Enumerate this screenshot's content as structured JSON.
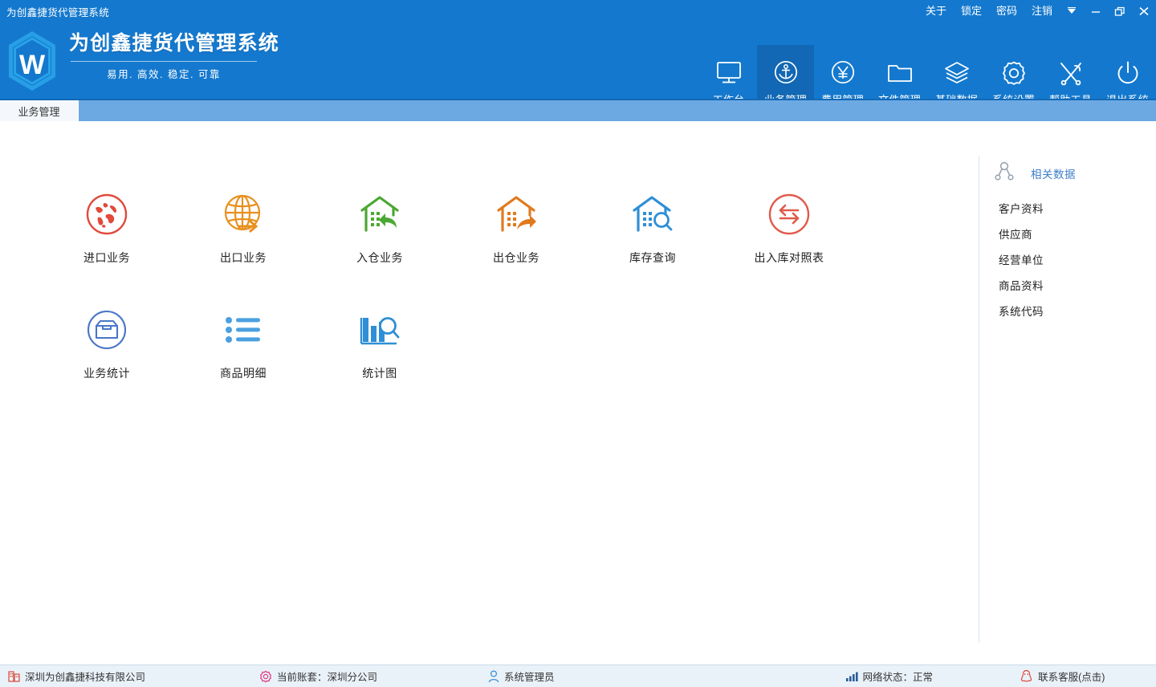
{
  "window": {
    "title": "为创鑫捷货代管理系统",
    "menu_links": [
      {
        "label": "关于",
        "name": "about"
      },
      {
        "label": "锁定",
        "name": "lock"
      },
      {
        "label": "密码",
        "name": "password"
      },
      {
        "label": "注销",
        "name": "logout"
      }
    ],
    "controls": [
      {
        "name": "skin-dropdown-icon",
        "glyph": "▼"
      },
      {
        "name": "minimize-icon",
        "glyph": "–"
      },
      {
        "name": "restore-icon",
        "glyph": "❐"
      },
      {
        "name": "close-icon",
        "glyph": "✕"
      }
    ]
  },
  "banner": {
    "logo_letter": "W",
    "title": "为创鑫捷货代管理系统",
    "subtitle": "易用. 高效. 稳定. 可靠",
    "bg_color": "#1479CE"
  },
  "topnav": {
    "active_index": 1,
    "items": [
      {
        "label": "工作台",
        "icon": "monitor-icon"
      },
      {
        "label": "业务管理",
        "icon": "anchor-circle-icon"
      },
      {
        "label": "费用管理",
        "icon": "yuan-circle-icon"
      },
      {
        "label": "文件管理",
        "icon": "folder-icon"
      },
      {
        "label": "基础数据",
        "icon": "layers-icon"
      },
      {
        "label": "系统设置",
        "icon": "gear-icon"
      },
      {
        "label": "帮助工具",
        "icon": "tools-icon"
      },
      {
        "label": "退出系统",
        "icon": "power-icon"
      }
    ]
  },
  "tabs": [
    {
      "label": "业务管理",
      "active": true
    }
  ],
  "main": {
    "tiles": [
      {
        "label": "进口业务",
        "icon": "globe-circle-icon",
        "color": "#E04A3A"
      },
      {
        "label": "出口业务",
        "icon": "globe-arrow-icon",
        "color": "#E8901E"
      },
      {
        "label": "入仓业务",
        "icon": "warehouse-in-icon",
        "color": "#4CA832"
      },
      {
        "label": "出仓业务",
        "icon": "warehouse-out-icon",
        "color": "#E07A1E"
      },
      {
        "label": "库存查询",
        "icon": "warehouse-search-icon",
        "color": "#2E8FD6"
      },
      {
        "label": "出入库对照表",
        "icon": "exchange-circle-icon",
        "color": "#E05A4A"
      },
      {
        "label": "业务统计",
        "icon": "archive-circle-icon",
        "color": "#4A76C8"
      },
      {
        "label": "商品明细",
        "icon": "list-icon",
        "color": "#4AA0E0"
      },
      {
        "label": "统计图",
        "icon": "bar-chart-search-icon",
        "color": "#2E8FD6"
      }
    ]
  },
  "right_panel": {
    "header": "相关数据",
    "header_icon": "relation-node-icon",
    "header_color": "#3F7FC8",
    "items": [
      {
        "label": "客户资料"
      },
      {
        "label": "供应商"
      },
      {
        "label": "经营单位"
      },
      {
        "label": "商品资料"
      },
      {
        "label": "系统代码"
      }
    ]
  },
  "statusbar": {
    "company": "深圳为创鑫捷科技有限公司",
    "account_set": "当前账套：深圳分公司",
    "user": "系统管理员",
    "network": "网络状态：正常",
    "support": "联系客服(点击)"
  }
}
